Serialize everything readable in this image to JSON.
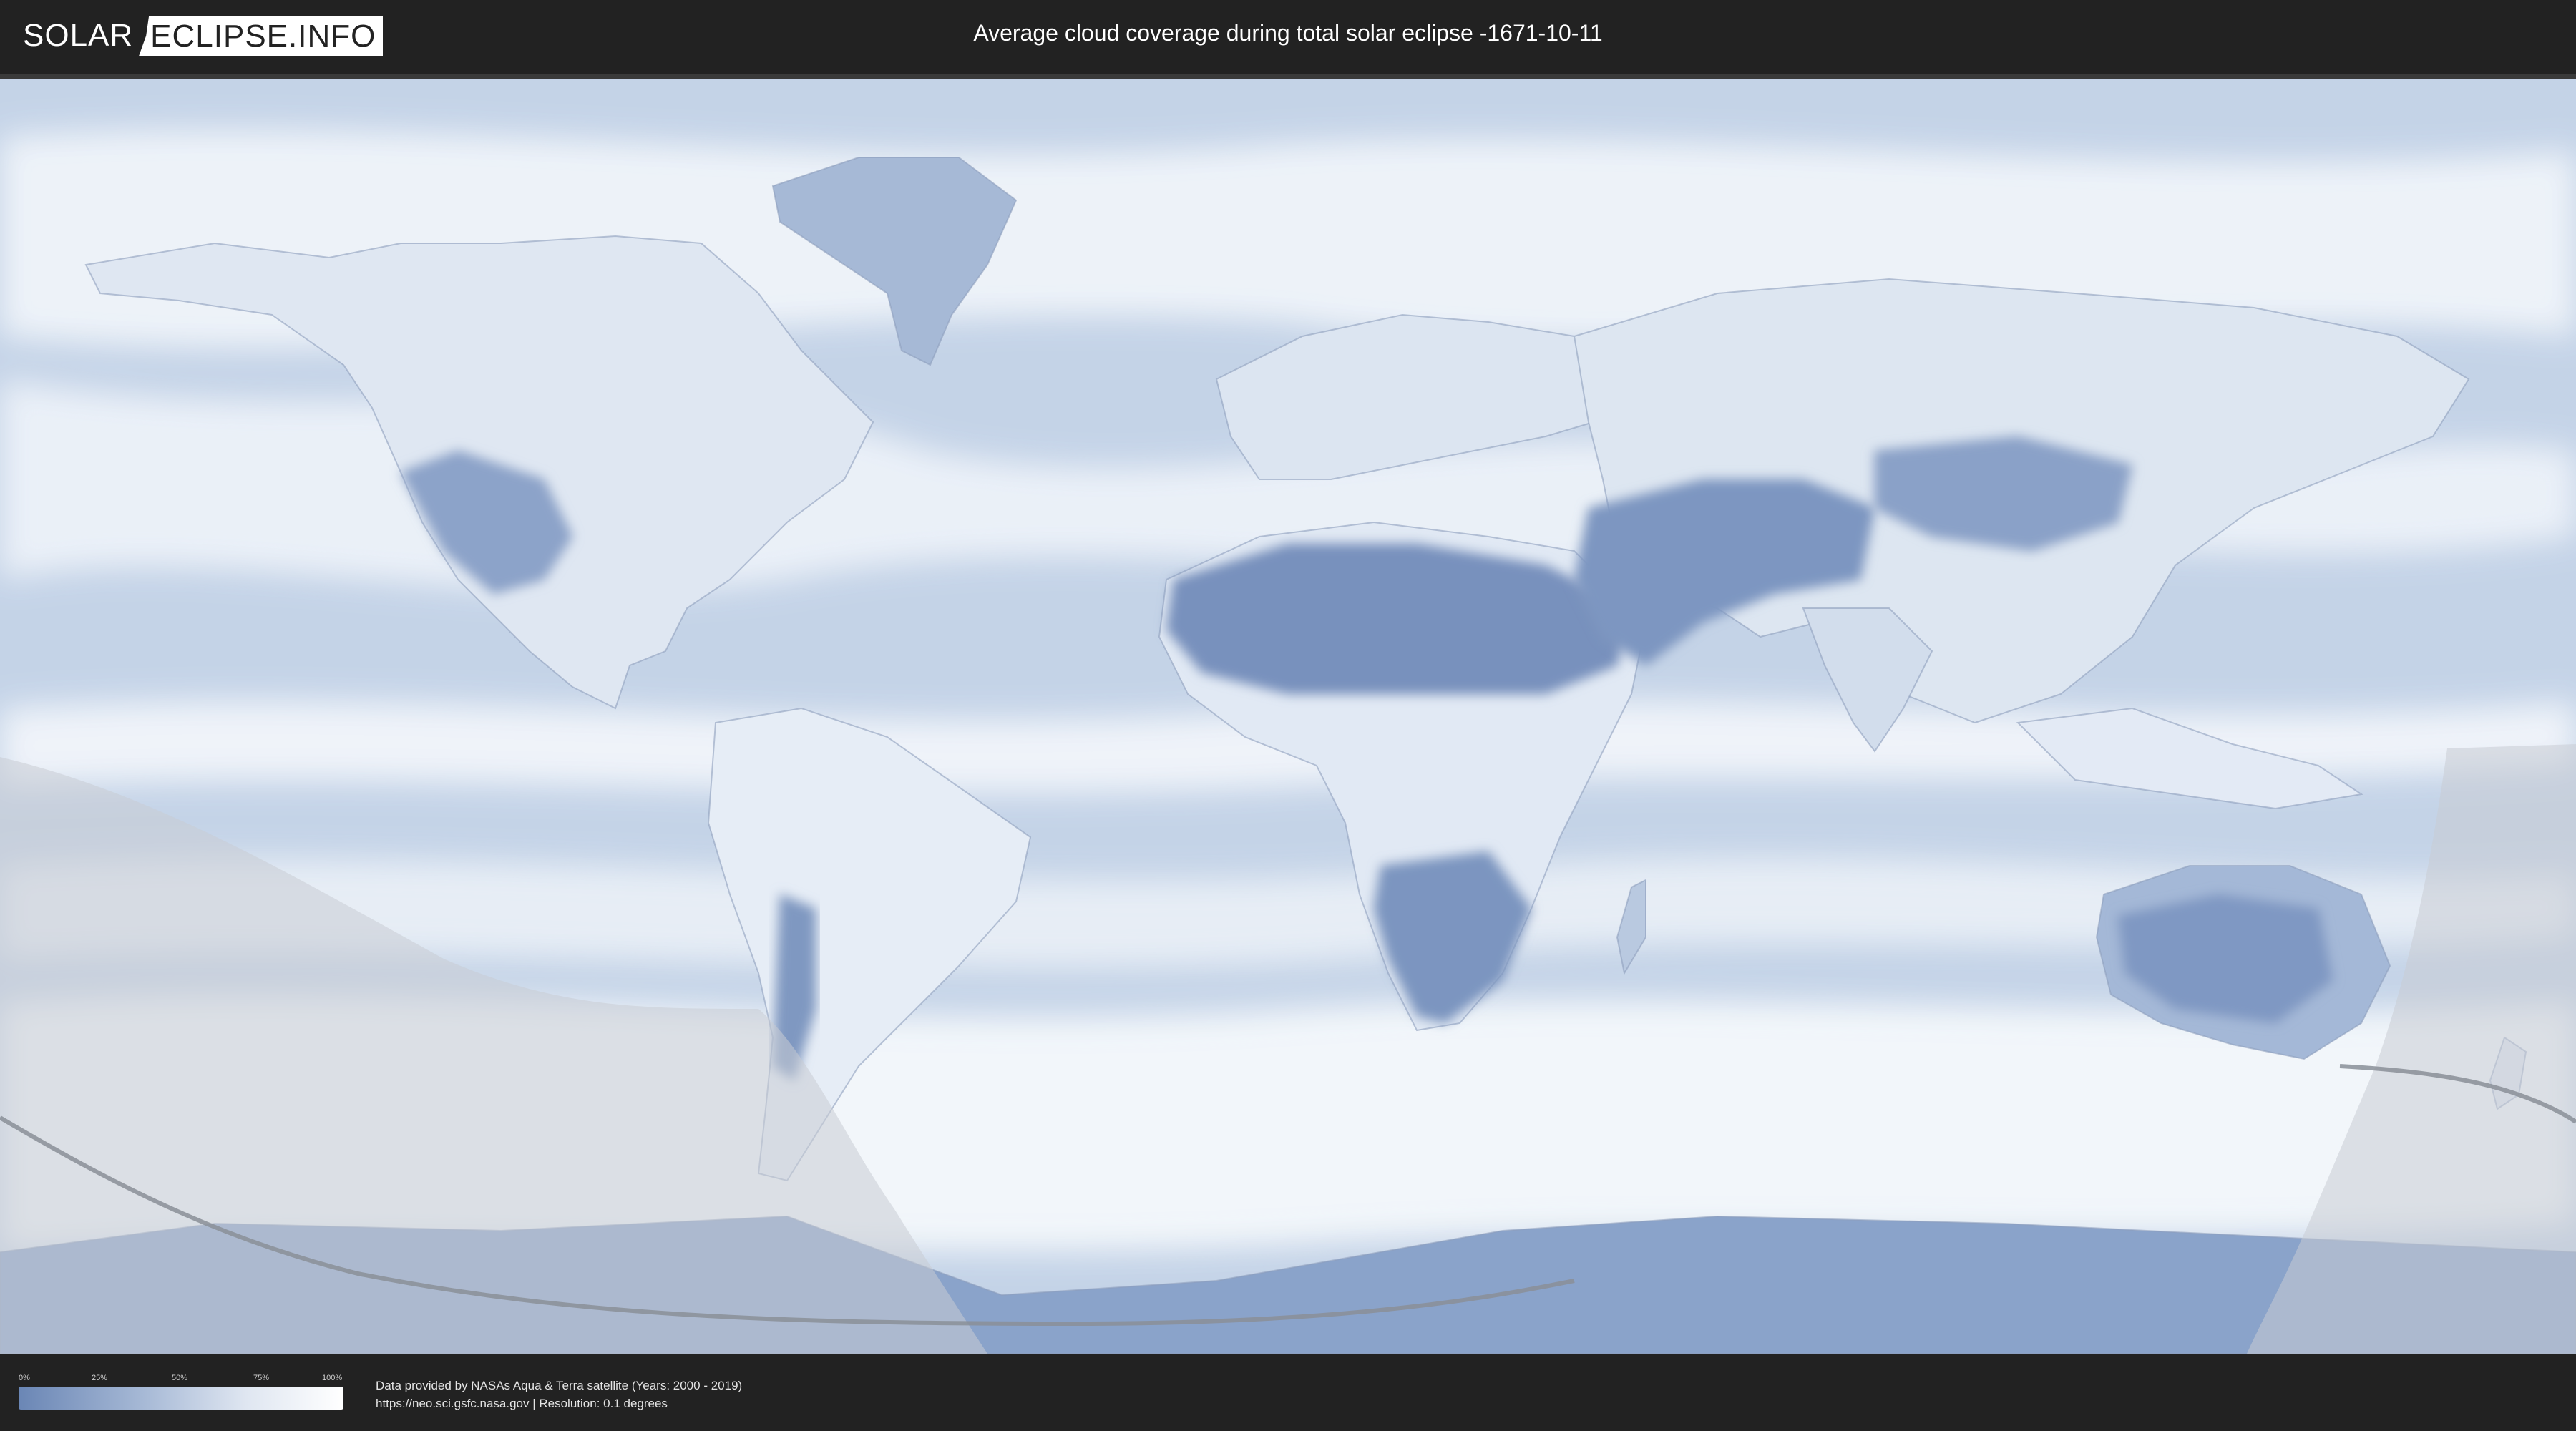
{
  "header": {
    "logo_left": "SOLAR",
    "logo_right": "ECLIPSE.INFO",
    "title": "Average cloud coverage during total solar eclipse -1671-10-11"
  },
  "legend": {
    "ticks": [
      "0%",
      "25%",
      "50%",
      "75%",
      "100%"
    ],
    "gradient_colors": [
      "#6a86b5",
      "#a9bbd7",
      "#dfe6f1",
      "#ffffff"
    ]
  },
  "footer": {
    "credit": "Data provided by NASAs Aqua & Terra satellite (Years: 2000 - 2019)",
    "source": "https://neo.sci.gsfc.nasa.gov | Resolution: 0.1 degrees"
  },
  "map": {
    "ocean_color": "#c4d3e7",
    "cloud_color": "#f4f7fb",
    "clear_land_color": "#7f98c1",
    "shadow_overlay_color": "#c8ccd3",
    "eclipse_path_color": "#8a8f98"
  }
}
